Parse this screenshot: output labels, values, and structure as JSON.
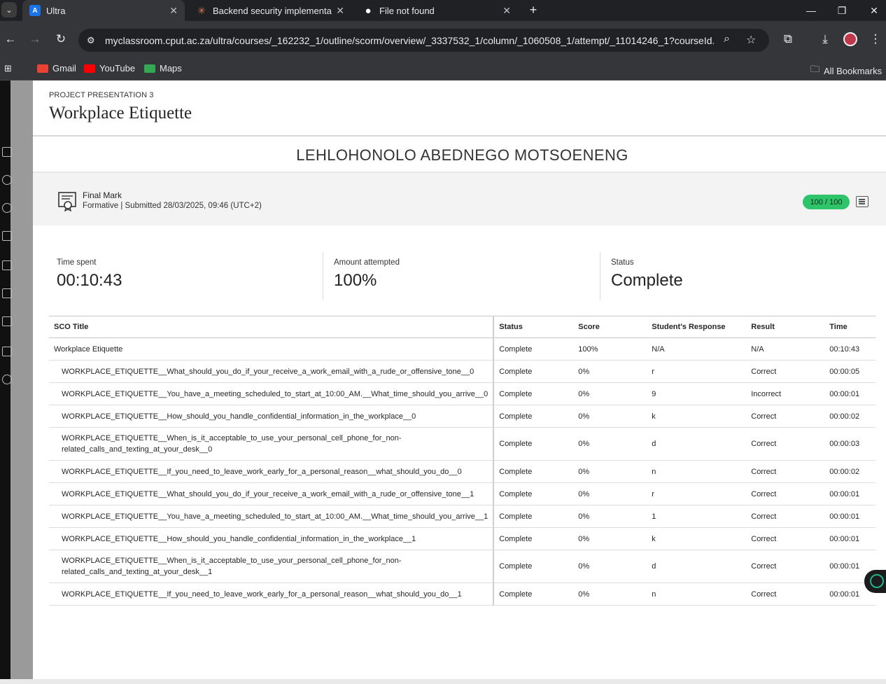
{
  "browser": {
    "tabs": [
      {
        "title": "Ultra",
        "favicon": "A",
        "favicon_color": "#1a73e8",
        "active": true
      },
      {
        "title": "Backend security implementatio",
        "favicon": "✳",
        "favicon_color": "#d97757",
        "active": false
      },
      {
        "title": "File not found",
        "favicon": "●",
        "favicon_color": "#ffffff",
        "active": false
      }
    ],
    "url": "myclassroom.cput.ac.za/ultra/courses/_162232_1/outline/scorm/overview/_3337532_1/column/_1060508_1/attempt/_11014246_1?courseId...",
    "bookmarks": [
      {
        "label": "Gmail",
        "color": "#ea4335"
      },
      {
        "label": "YouTube",
        "color": "#ff0000"
      },
      {
        "label": "Maps",
        "color": "#34a853"
      }
    ],
    "all_bookmarks": "All Bookmarks"
  },
  "panel": {
    "kicker": "PROJECT PRESENTATION 3",
    "title": "Workplace Etiquette",
    "student_name": "LEHLOHONOLO ABEDNEGO MOTSOENENG",
    "final_mark": {
      "label": "Final Mark",
      "subtitle": "Formative | Submitted 28/03/2025, 09:46 (UTC+2)",
      "grade": "100 / 100",
      "grade_color": "#2ec46a"
    },
    "stats": [
      {
        "label": "Time spent",
        "value": "00:10:43"
      },
      {
        "label": "Amount attempted",
        "value": "100%"
      },
      {
        "label": "Status",
        "value": "Complete"
      }
    ],
    "table": {
      "headers": [
        "SCO Title",
        "Status",
        "Score",
        "Student's Response",
        "Result",
        "Time"
      ],
      "rows": [
        [
          "Workplace Etiquette",
          "Complete",
          "100%",
          "N/A",
          "N/A",
          "00:10:43"
        ],
        [
          "WORKPLACE_ETIQUETTE__What_should_you_do_if_your_receive_a_work_email_with_a_rude_or_offensive_tone__0",
          "Complete",
          "0%",
          "r",
          "Correct",
          "00:00:05"
        ],
        [
          "WORKPLACE_ETIQUETTE__You_have_a_meeting_scheduled_to_start_at_10:00_AM.__What_time_should_you_arrive__0",
          "Complete",
          "0%",
          "9",
          "Incorrect",
          "00:00:01"
        ],
        [
          "WORKPLACE_ETIQUETTE__How_should_you_handle_confidential_information_in_the_workplace__0",
          "Complete",
          "0%",
          "k",
          "Correct",
          "00:00:02"
        ],
        [
          "WORKPLACE_ETIQUETTE__When_is_it_acceptable_to_use_your_personal_cell_phone_for_non-related_calls_and_texting_at_your_desk__0",
          "Complete",
          "0%",
          "d",
          "Correct",
          "00:00:03"
        ],
        [
          "WORKPLACE_ETIQUETTE__If_you_need_to_leave_work_early_for_a_personal_reason__what_should_you_do__0",
          "Complete",
          "0%",
          "n",
          "Correct",
          "00:00:02"
        ],
        [
          "WORKPLACE_ETIQUETTE__What_should_you_do_if_your_receive_a_work_email_with_a_rude_or_offensive_tone__1",
          "Complete",
          "0%",
          "r",
          "Correct",
          "00:00:01"
        ],
        [
          "WORKPLACE_ETIQUETTE__You_have_a_meeting_scheduled_to_start_at_10:00_AM.__What_time_should_you_arrive__1",
          "Complete",
          "0%",
          "1",
          "Correct",
          "00:00:01"
        ],
        [
          "WORKPLACE_ETIQUETTE__How_should_you_handle_confidential_information_in_the_workplace__1",
          "Complete",
          "0%",
          "k",
          "Correct",
          "00:00:01"
        ],
        [
          "WORKPLACE_ETIQUETTE__When_is_it_acceptable_to_use_your_personal_cell_phone_for_non-related_calls_and_texting_at_your_desk__1",
          "Complete",
          "0%",
          "d",
          "Correct",
          "00:00:01"
        ],
        [
          "WORKPLACE_ETIQUETTE__If_you_need_to_leave_work_early_for_a_personal_reason__what_should_you_do__1",
          "Complete",
          "0%",
          "n",
          "Correct",
          "00:00:01"
        ]
      ]
    }
  }
}
